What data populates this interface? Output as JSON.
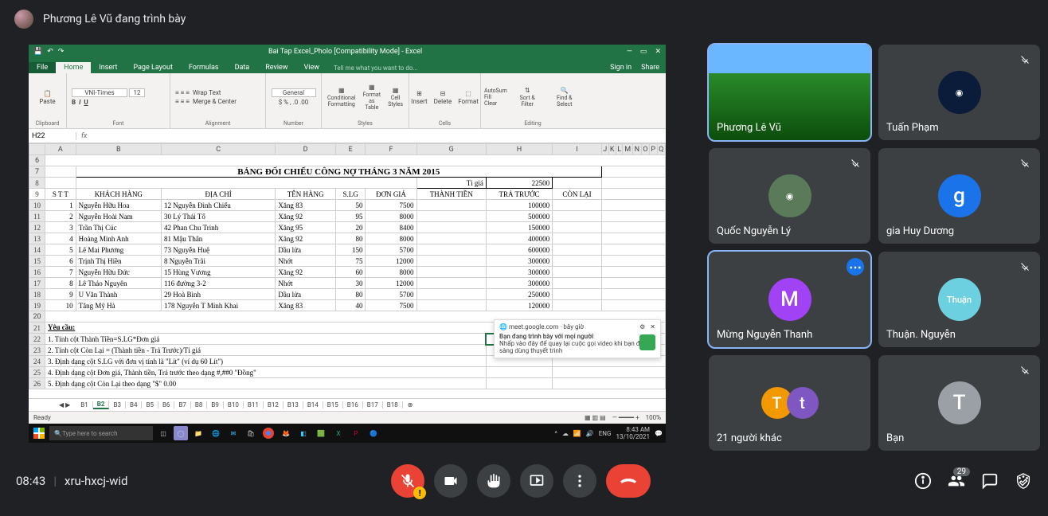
{
  "presenting_bar": "Phương Lê Vũ đang trình bày",
  "excel": {
    "title": "Bai Tap Excel_Pholo  [Compatibility Mode]  -  Excel",
    "menu_signin": "Sign in",
    "menu_share": "Share",
    "tabs": {
      "file": "File",
      "home": "Home",
      "insert": "Insert",
      "pagelayout": "Page Layout",
      "formulas": "Formulas",
      "data": "Data",
      "review": "Review",
      "view": "View",
      "tell": "Tell me what you want to do..."
    },
    "ribbon": {
      "clipboard": "Clipboard",
      "paste": "Paste",
      "font": "Font",
      "fontname": "VNI-Times",
      "fontsize": "12",
      "alignment": "Alignment",
      "wrap": "Wrap Text",
      "merge": "Merge & Center",
      "number": "Number",
      "numfmt": "General",
      "styles": "Styles",
      "condfmt": "Conditional Formatting",
      "fmttable": "Format as Table",
      "cellstyles": "Cell Styles",
      "cells": "Cells",
      "insert": "Insert",
      "delete": "Delete",
      "format": "Format",
      "editing": "Editing",
      "autosum": "AutoSum",
      "fill": "Fill",
      "clear": "Clear",
      "sort": "Sort & Filter",
      "find": "Find & Select"
    },
    "namebox": "H22",
    "sheet": {
      "title": "BẢNG ĐỐI CHIẾU CÔNG NỢ THÁNG 3 NĂM 2015",
      "tigia_label": "Tỉ giá",
      "tigia_val": "22500",
      "headers": {
        "stt": "S T T",
        "kh": "KHÁCH HÀNG",
        "dc": "ĐỊA CHỈ",
        "th": "TÊN HÀNG",
        "slg": "S.LG",
        "dg": "ĐƠN GIÁ",
        "tt": "THÀNH TIỀN",
        "tr": "TRẢ TRƯỚC",
        "cl": "CÒN LẠI"
      },
      "rows": [
        {
          "n": "1",
          "kh": "Nguyễn Hữu Hoa",
          "dc": "12 Nguyễn Đình Chiểu",
          "th": "Xăng 83",
          "sl": "50",
          "dg": "7500",
          "tr": "100000"
        },
        {
          "n": "2",
          "kh": "Nguyễn Hoài Nam",
          "dc": "30 Lý Thái Tổ",
          "th": "Xăng 92",
          "sl": "95",
          "dg": "8000",
          "tr": "500000"
        },
        {
          "n": "3",
          "kh": "Trần Thị Cúc",
          "dc": "42 Phan Chu Trinh",
          "th": "Xăng 95",
          "sl": "20",
          "dg": "8400",
          "tr": "150000"
        },
        {
          "n": "4",
          "kh": "Hoàng Minh Anh",
          "dc": "81 Mậu Thân",
          "th": "Xăng 92",
          "sl": "80",
          "dg": "8000",
          "tr": "400000"
        },
        {
          "n": "5",
          "kh": "Lê Mai Phương",
          "dc": "73 Nguyễn Huệ",
          "th": "Dầu lửa",
          "sl": "150",
          "dg": "5700",
          "tr": "600000"
        },
        {
          "n": "6",
          "kh": "Trịnh Thị Hiền",
          "dc": "8 Nguyễn Trãi",
          "th": "Nhớt",
          "sl": "75",
          "dg": "12000",
          "tr": "300000"
        },
        {
          "n": "7",
          "kh": "Nguyễn Hữu Đức",
          "dc": "15 Hùng Vương",
          "th": "Xăng 92",
          "sl": "60",
          "dg": "8000",
          "tr": "300000"
        },
        {
          "n": "8",
          "kh": "Lê Thảo Nguyên",
          "dc": "116 đường 3-2",
          "th": "Nhớt",
          "sl": "30",
          "dg": "12000",
          "tr": "300000"
        },
        {
          "n": "9",
          "kh": "U Văn Thành",
          "dc": "29 Hoà Bình",
          "th": "Dầu lửa",
          "sl": "80",
          "dg": "5700",
          "tr": "250000"
        },
        {
          "n": "10",
          "kh": "Tăng Mỹ Hà",
          "dc": "178 Nguyễn T Minh Khai",
          "th": "Xăng 83",
          "sl": "40",
          "dg": "7500",
          "tr": "120000"
        }
      ],
      "req_title": "Yêu cầu:",
      "req": [
        "1. Tính cột Thành Tiền=S.LG*Đơn giá",
        "2. Tính cột Còn Lại = (Thành tiền - Trả Trước)/Tỉ giá",
        "3. Định dạng cột S.LG với đơn vị tính là \"Lít\" (ví dụ 60 Lít\")",
        "4. Định dạng cột Đơn giá, Thành tiền, Trả trước theo dạng #,##0 \"Đồng\"",
        "5. Định dạng cột Còn Lại theo dạng \"$\" 0.00"
      ]
    },
    "sheets": [
      "B1",
      "B2",
      "B3",
      "B4",
      "B5",
      "B6",
      "B7",
      "B8",
      "B9",
      "B10",
      "B11",
      "B12",
      "B13",
      "B14",
      "B15",
      "B16",
      "B17",
      "B18"
    ],
    "status": "Ready",
    "zoom": "100%"
  },
  "toast": {
    "src": "meet.google.com · bây giờ",
    "line1": "Bạn đang trình bày với mọi người",
    "line2": "Nhấp vào đây để quay lại cuộc gọi video khi bạn đã sẵn sàng dùng thuyết trình"
  },
  "taskbar": {
    "search": "Type here to search",
    "time": "8:43 AM",
    "date": "13/10/2021",
    "lang": "ENG"
  },
  "participants": [
    {
      "name": "Phương Lê Vũ",
      "type": "landscape",
      "speaking": true
    },
    {
      "name": "Tuấn Phạm",
      "type": "avatar",
      "color": "#0b1c3a",
      "mute": true,
      "img": true
    },
    {
      "name": "Quốc Nguyễn Lý",
      "type": "avatar",
      "color": "#5a7a5a",
      "mute": true,
      "img": true
    },
    {
      "name": "gia Huy Dương",
      "type": "letter",
      "letter": "g",
      "color": "#1a73e8",
      "mute": true
    },
    {
      "name": "Mừng Nguyễn Thanh",
      "type": "letter",
      "letter": "M",
      "color": "#a142f4",
      "speaking": true,
      "more": true
    },
    {
      "name": "Thuận. Nguyễn",
      "type": "avatar",
      "color": "#6dd0e0",
      "mute": true,
      "img": true,
      "text": "Thuận"
    },
    {
      "name": "21 người khác",
      "type": "pair",
      "mute": false,
      "pair": [
        {
          "l": "T",
          "c": "#f29900"
        },
        {
          "l": "t",
          "c": "#7e57c2"
        }
      ]
    },
    {
      "name": "Bạn",
      "type": "letter",
      "letter": "T",
      "color": "#9aa0a6",
      "mute": true
    }
  ],
  "bottom": {
    "time": "08:43",
    "code": "xru-hxcj-wid",
    "people_count": "29"
  }
}
